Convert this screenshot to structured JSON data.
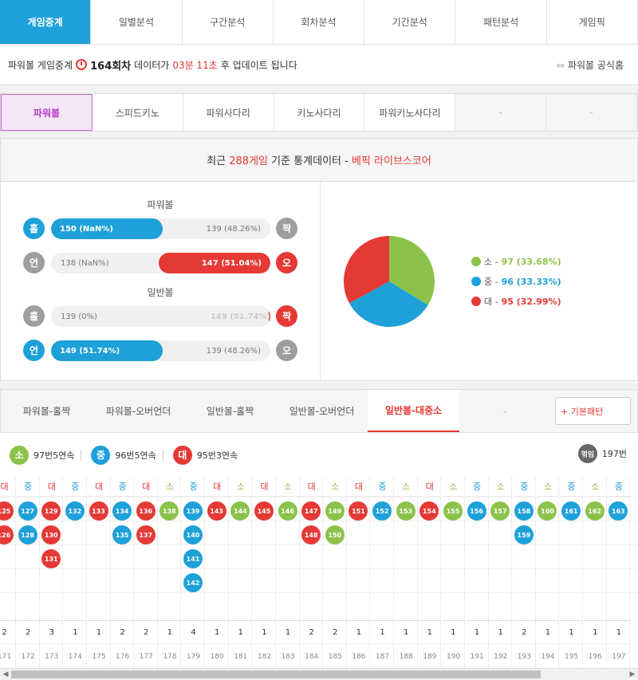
{
  "top_tabs": [
    {
      "label": "게임중계",
      "active": true
    },
    {
      "label": "일별분석",
      "active": false
    },
    {
      "label": "구간분석",
      "active": false
    },
    {
      "label": "회차분석",
      "active": false
    },
    {
      "label": "기간분석",
      "active": false
    },
    {
      "label": "패턴분석",
      "active": false
    },
    {
      "label": "게임픽",
      "active": false
    }
  ],
  "info": {
    "prefix": "파워볼 게임중계",
    "round": "164회차",
    "mid": "데이터가",
    "time": "03분 11초",
    "suffix": "후 업데이트 됩니다",
    "official_link": "파워볼 공식홈"
  },
  "game_tabs": [
    {
      "label": "파워볼",
      "state": "active"
    },
    {
      "label": "스피드키노",
      "state": "normal"
    },
    {
      "label": "파워사다리",
      "state": "normal"
    },
    {
      "label": "키노사다리",
      "state": "normal"
    },
    {
      "label": "파워키노사다리",
      "state": "normal"
    },
    {
      "label": "-",
      "state": "dim"
    },
    {
      "label": "-",
      "state": "dim"
    }
  ],
  "stat_header": {
    "prefix": "최근",
    "count": "288게임",
    "mid": "기준 통계데이터 -",
    "brand": "베픽 라이브스코어"
  },
  "powerball_label": "파워볼",
  "normal_label": "일반볼",
  "bars": [
    {
      "left_icon": "홀",
      "left_color": "#1ea0d9",
      "left_text": "150 (NaN%)",
      "left_filled": true,
      "left_pct": 0.51,
      "right_text": "139 (48.26%)",
      "right_filled": false,
      "right_icon": "짝",
      "right_color": "#9e9e9e"
    },
    {
      "left_icon": "언",
      "left_color": "#9e9e9e",
      "left_text": "138 (NaN%)",
      "left_filled": false,
      "right_text": "147 (51.04%)",
      "right_filled": true,
      "right_pct": 0.51,
      "right_icon": "오",
      "right_color": "#e53935"
    },
    {
      "left_icon": "홀",
      "left_color": "#9e9e9e",
      "left_text": "139 (0%)",
      "left_filled": false,
      "right_text": "149 (51.74%)",
      "right_filled": true,
      "right_pct": 0.0,
      "right_icon": "짝",
      "right_color": "#e53935"
    },
    {
      "left_icon": "언",
      "left_color": "#1ea0d9",
      "left_text": "149 (51.74%)",
      "left_filled": true,
      "left_pct": 0.51,
      "right_text": "139 (48.26%)",
      "right_filled": false,
      "right_icon": "오",
      "right_color": "#9e9e9e"
    }
  ],
  "pie": [
    {
      "label": "소",
      "value": "97",
      "pct": "(33.68%)",
      "color": "#8bc34a",
      "frac": 0.3368
    },
    {
      "label": "중",
      "value": "96",
      "pct": "(33.33%)",
      "color": "#1ea0d9",
      "frac": 0.3333
    },
    {
      "label": "대",
      "value": "95",
      "pct": "(32.99%)",
      "color": "#e53935",
      "frac": 0.3299
    }
  ],
  "pattern_tabs": [
    {
      "label": "파워볼-홀짝",
      "state": "normal"
    },
    {
      "label": "파워볼-오버언더",
      "state": "normal"
    },
    {
      "label": "일반볼-홀짝",
      "state": "normal"
    },
    {
      "label": "일반볼-오버언더",
      "state": "normal"
    },
    {
      "label": "일반볼-대중소",
      "state": "active"
    },
    {
      "label": "-",
      "state": "dim"
    }
  ],
  "basic_pattern_button": "+ 기본패턴",
  "summary": [
    {
      "icon": "소",
      "color": "#8bc34a",
      "text": "97번5연속"
    },
    {
      "icon": "중",
      "color": "#1ea0d9",
      "text": "96번5연속"
    },
    {
      "icon": "대",
      "color": "#e53935",
      "text": "95번3연속"
    }
  ],
  "summary_right": {
    "icon": "꺾임",
    "color": "#666666",
    "text": "197번"
  },
  "colors": {
    "대": "#e53935",
    "중": "#1ea0d9",
    "소": "#8bc34a",
    "대_text": "#e53935",
    "중_text": "#1ea0d9",
    "소_text": "#8bc34a"
  },
  "columns": [
    {
      "type": "대",
      "balls": [
        "125",
        "126"
      ],
      "count": "2",
      "round": "171"
    },
    {
      "type": "중",
      "balls": [
        "127",
        "128"
      ],
      "count": "2",
      "round": "172"
    },
    {
      "type": "대",
      "balls": [
        "129",
        "130",
        "131"
      ],
      "count": "3",
      "round": "173"
    },
    {
      "type": "중",
      "balls": [
        "132"
      ],
      "count": "1",
      "round": "174"
    },
    {
      "type": "대",
      "balls": [
        "133"
      ],
      "count": "1",
      "round": "175"
    },
    {
      "type": "중",
      "balls": [
        "134",
        "135"
      ],
      "count": "2",
      "round": "176"
    },
    {
      "type": "대",
      "balls": [
        "136",
        "137"
      ],
      "count": "2",
      "round": "177"
    },
    {
      "type": "소",
      "balls": [
        "138"
      ],
      "count": "1",
      "round": "178"
    },
    {
      "type": "중",
      "balls": [
        "139",
        "140",
        "141",
        "142"
      ],
      "count": "4",
      "round": "179"
    },
    {
      "type": "대",
      "balls": [
        "143"
      ],
      "count": "1",
      "round": "180"
    },
    {
      "type": "소",
      "balls": [
        "144"
      ],
      "count": "1",
      "round": "181"
    },
    {
      "type": "대",
      "balls": [
        "145"
      ],
      "count": "1",
      "round": "182"
    },
    {
      "type": "소",
      "balls": [
        "146"
      ],
      "count": "1",
      "round": "183"
    },
    {
      "type": "대",
      "balls": [
        "147",
        "148"
      ],
      "count": "2",
      "round": "184"
    },
    {
      "type": "소",
      "balls": [
        "149",
        "150"
      ],
      "count": "2",
      "round": "185"
    },
    {
      "type": "대",
      "balls": [
        "151"
      ],
      "count": "1",
      "round": "186"
    },
    {
      "type": "중",
      "balls": [
        "152"
      ],
      "count": "1",
      "round": "187"
    },
    {
      "type": "소",
      "balls": [
        "153"
      ],
      "count": "1",
      "round": "188"
    },
    {
      "type": "대",
      "balls": [
        "154"
      ],
      "count": "1",
      "round": "189"
    },
    {
      "type": "소",
      "balls": [
        "155"
      ],
      "count": "1",
      "round": "190"
    },
    {
      "type": "중",
      "balls": [
        "156"
      ],
      "count": "1",
      "round": "191"
    },
    {
      "type": "소",
      "balls": [
        "157"
      ],
      "count": "1",
      "round": "192"
    },
    {
      "type": "중",
      "balls": [
        "158",
        "159"
      ],
      "count": "2",
      "round": "193"
    },
    {
      "type": "소",
      "balls": [
        "160"
      ],
      "count": "1",
      "round": "194"
    },
    {
      "type": "중",
      "balls": [
        "161"
      ],
      "count": "1",
      "round": "195"
    },
    {
      "type": "소",
      "balls": [
        "162"
      ],
      "count": "1",
      "round": "196"
    },
    {
      "type": "중",
      "balls": [
        "163"
      ],
      "count": "1",
      "round": "197"
    }
  ]
}
